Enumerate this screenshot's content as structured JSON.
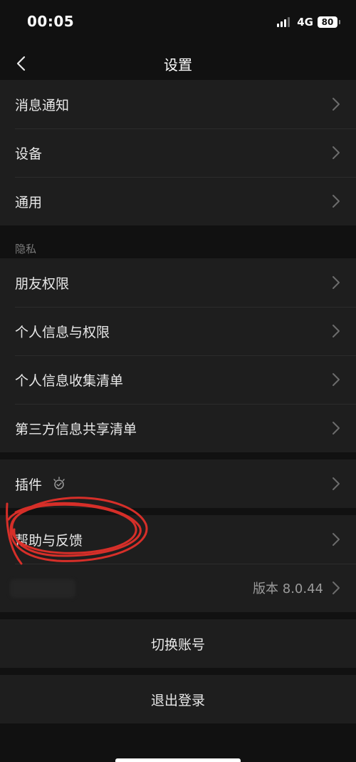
{
  "status_bar": {
    "time": "00:05",
    "network": "4G",
    "battery": "80"
  },
  "nav": {
    "title": "设置"
  },
  "groups": {
    "general": [
      {
        "label": "消息通知"
      },
      {
        "label": "设备"
      },
      {
        "label": "通用"
      }
    ],
    "privacy_header": "隐私",
    "privacy": [
      {
        "label": "朋友权限"
      },
      {
        "label": "个人信息与权限"
      },
      {
        "label": "个人信息收集清单"
      },
      {
        "label": "第三方信息共享清单"
      }
    ],
    "plugins": {
      "label": "插件"
    },
    "about": {
      "help_label": "帮助与反馈",
      "version": "版本 8.0.44"
    }
  },
  "actions": {
    "switch_account": "切换账号",
    "logout": "退出登录"
  },
  "colors": {
    "background": "#111111",
    "cell": "#1e1e1e",
    "annotation": "#e0302a"
  },
  "icons": {
    "back": "chevron-left-icon",
    "row": "chevron-right-icon",
    "plugin": "plugin-bulb-icon"
  }
}
